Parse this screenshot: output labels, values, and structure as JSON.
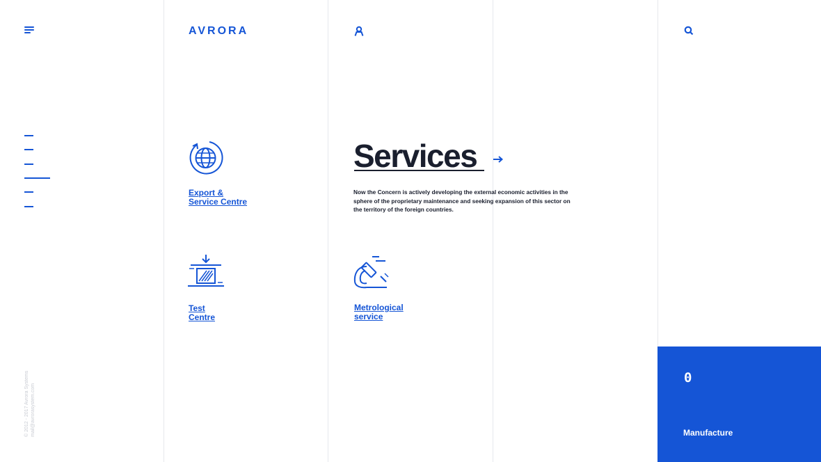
{
  "brand": {
    "logo_text": "AVRORA",
    "accent_color": "#1555d6",
    "text_color": "#1a1f2e"
  },
  "header": {
    "menu_icon": "hamburger-menu-icon",
    "user_icon": "user-icon",
    "search_icon": "search-icon"
  },
  "slide_nav": {
    "item_count": 6,
    "active_index": 3
  },
  "copyright": {
    "line1": "© 2012 - 2017 Avrora Systems",
    "line2": "mail@avrorasystem.com"
  },
  "section": {
    "title": "Services",
    "description": "Now the Concern is actively developing the external economic activities in the sphere of the proprietary maintenance and seeking expansion of this sector on the territory of the foreign countries."
  },
  "services": [
    {
      "line1": "Export &",
      "line2": "Service Centre",
      "icon": "globe-export-icon"
    },
    {
      "line1": "Test",
      "line2": "Centre",
      "icon": "press-test-icon"
    },
    {
      "line1": "Metrological",
      "line2": "service",
      "icon": "microscope-icon"
    }
  ],
  "panel": {
    "number": "0",
    "label": "Manufacture"
  }
}
